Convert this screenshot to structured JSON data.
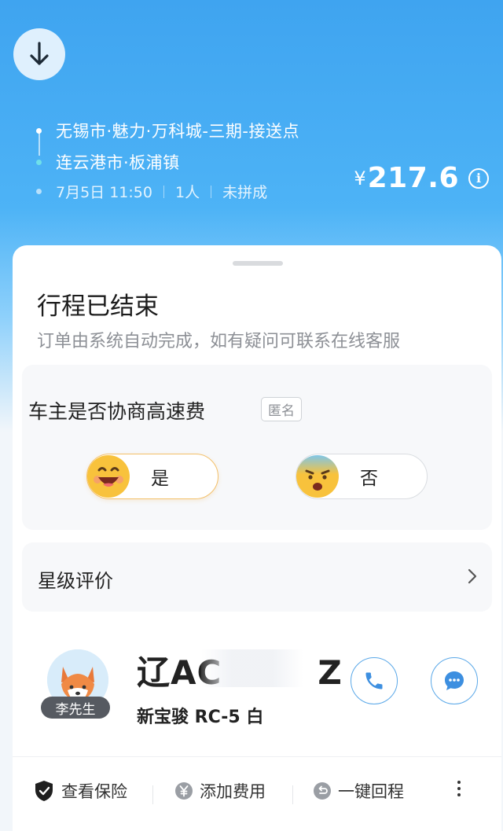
{
  "route": {
    "origin": "无锡市·魅力·万科城-三期-接送点",
    "destination": "连云港市·板浦镇",
    "date_time": "7月5日 11:50",
    "passengers": "1人",
    "carpool": "未拼成"
  },
  "price": {
    "currency": "¥",
    "amount": "217.6",
    "info_icon": "i"
  },
  "status": {
    "title": "行程已结束",
    "subtitle": "订单由系统自动完成，如有疑问可联系在线客服"
  },
  "question": {
    "title": "车主是否协商高速费",
    "anonymous_badge": "匿名",
    "yes_label": "是",
    "no_label": "否"
  },
  "rating": {
    "label": "星级评价"
  },
  "driver": {
    "name": "李先生",
    "plate": "辽AC",
    "plate_tail": "Z",
    "car": "新宝骏 RC-5 白"
  },
  "actions": {
    "insurance": "查看保险",
    "add_fee": "添加费用",
    "return_trip": "一键回程"
  },
  "colors": {
    "accent": "#3fa4f0",
    "yes_border": "#f3c06a",
    "icon_blue": "#5aa8e8"
  }
}
